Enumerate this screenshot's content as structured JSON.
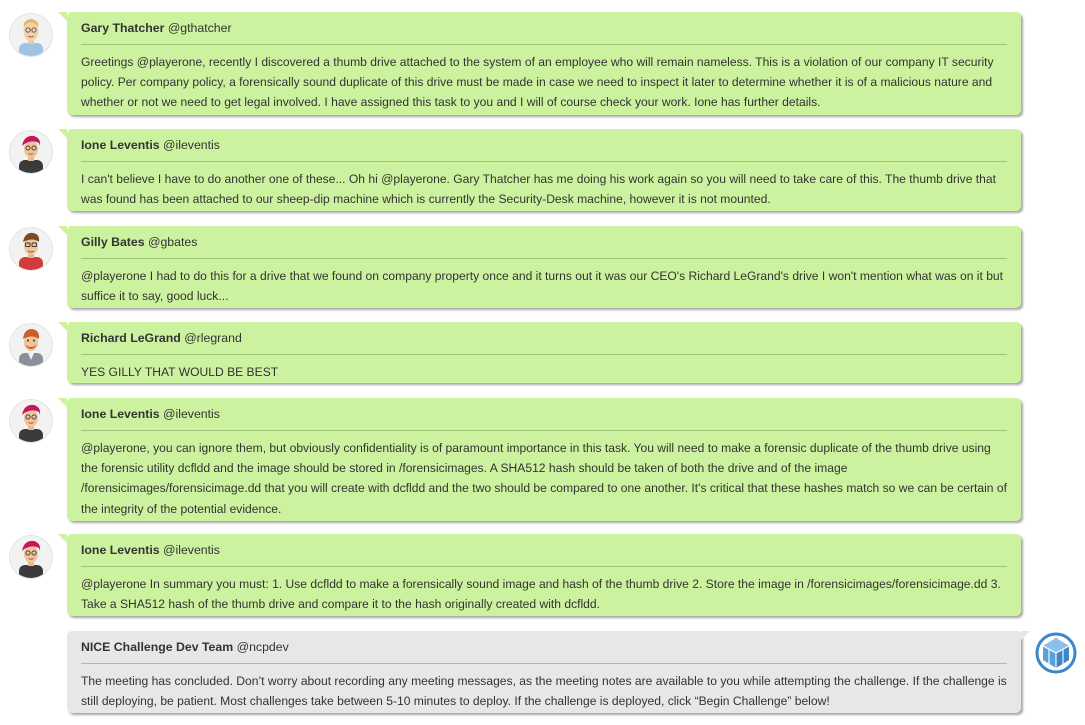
{
  "messages": [
    {
      "name": "Gary Thatcher",
      "handle": "@gthatcher",
      "avatar_icon": "gary-thatcher-avatar-icon",
      "text": "Greetings @playerone, recently I discovered a thumb drive attached to the system of an employee who will remain nameless. This is a violation of our company IT security policy. Per company policy, a forensically sound duplicate of this drive must be made in case we need to inspect it later to determine whether it is of a malicious nature and whether or not we need to get legal involved. I have assigned this task to you and I will of course check your work. Ione has further details."
    },
    {
      "name": "Ione Leventis",
      "handle": "@ileventis",
      "avatar_icon": "ione-leventis-avatar-icon",
      "text": "I can't believe I have to do another one of these... Oh hi @playerone. Gary Thatcher has me doing his work again so you will need to take care of this. The thumb drive that was found has been attached to our sheep-dip machine which is currently the Security-Desk machine, however it is not mounted."
    },
    {
      "name": "Gilly Bates",
      "handle": "@gbates",
      "avatar_icon": "gilly-bates-avatar-icon",
      "text": "@playerone I had to do this for a drive that we found on company property once and it turns out it was our CEO's Richard LeGrand's drive I won't mention what was on it but suffice it to say, good luck..."
    },
    {
      "name": "Richard LeGrand",
      "handle": "@rlegrand",
      "avatar_icon": "richard-legrand-avatar-icon",
      "text": "YES GILLY THAT WOULD BE BEST"
    },
    {
      "name": "Ione Leventis",
      "handle": "@ileventis",
      "avatar_icon": "ione-leventis-avatar-icon",
      "text": "@playerone, you can ignore them, but obviously confidentiality is of paramount importance in this task. You will need to make a forensic duplicate of the thumb drive using the forensic utility dcfldd and the image should be stored in /forensicimages. A SHA512 hash should be taken of both the drive and of the image /forensicimages/forensicimage.dd that you will create with dcfldd and the two should be compared to one another. It's critical that these hashes match so we can be certain of the integrity of the potential evidence."
    },
    {
      "name": "Ione Leventis",
      "handle": "@ileventis",
      "avatar_icon": "ione-leventis-avatar-icon",
      "text": "@playerone In summary you must: 1. Use dcfldd to make a forensically sound image and hash of the thumb drive 2. Store the image in /forensicimages/forensicimage.dd 3. Take a SHA512 hash of the thumb drive and compare it to the hash originally created with dcfldd."
    },
    {
      "name": "NICE Challenge Dev Team",
      "handle": "@ncpdev",
      "avatar_icon": "nice-challenge-logo-icon",
      "text": "The meeting has concluded. Don’t worry about recording any meeting messages, as the meeting notes are available to you while attempting the challenge. If the challenge is still deploying, be patient. Most challenges take between 5-10 minutes to deploy. If the challenge is deployed, click “Begin Challenge” below!"
    }
  ],
  "colors": {
    "team_bubble": "#ccf29f",
    "system_bubble": "#e7e7e7",
    "text": "#333333",
    "logo_blue": "#3b87c9"
  }
}
